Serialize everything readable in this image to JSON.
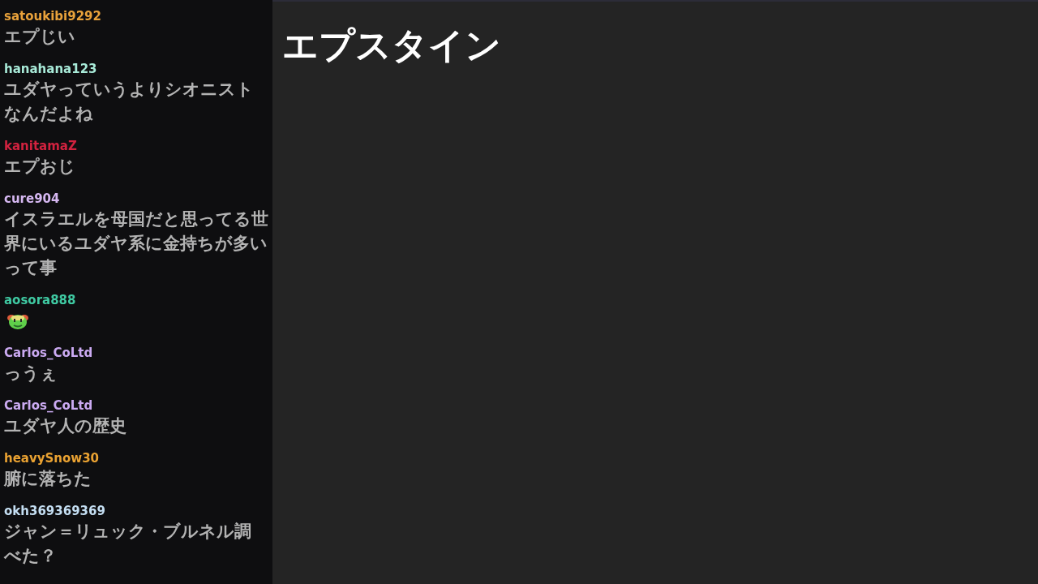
{
  "chat": {
    "messages": [
      {
        "user": "satoukibi9292",
        "color": "#e9a23b",
        "kind": "text",
        "text": "エプじい"
      },
      {
        "user": "hanahana123",
        "color": "#a8ead8",
        "kind": "text",
        "text": "ユダヤっていうよりシオニストなんだよね"
      },
      {
        "user": "kanitamaZ",
        "color": "#d2223f",
        "kind": "text",
        "text": "エプおじ"
      },
      {
        "user": "cure904",
        "color": "#d6b8f2",
        "kind": "text",
        "text": "イスラエルを母国だと思ってる世界にいるユダヤ系に金持ちが多いって事"
      },
      {
        "user": "aosora888",
        "color": "#3fc9a2",
        "kind": "emote"
      },
      {
        "user": "Carlos_CoLtd",
        "color": "#cbaaf2",
        "kind": "text",
        "text": "っうぇ"
      },
      {
        "user": "Carlos_CoLtd",
        "color": "#cbaaf2",
        "kind": "text",
        "text": "ユダヤ人の歴史"
      },
      {
        "user": "heavySnow30",
        "color": "#eaa232",
        "kind": "text",
        "text": "腑に落ちた"
      },
      {
        "user": "okh369369369",
        "color": "#c4def2",
        "kind": "text",
        "text": "ジャン＝リュック・ブルネル調べた？"
      }
    ]
  },
  "main": {
    "title": "エプスタイン"
  }
}
